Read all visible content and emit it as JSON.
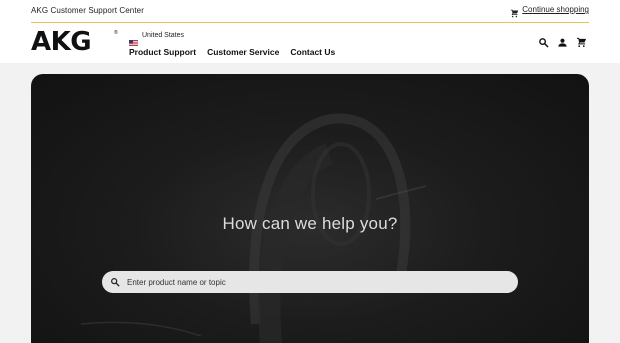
{
  "topbar": {
    "title": "AKG Customer Support Center",
    "continue_label": "Continue shopping",
    "cart_icon": "cart-icon"
  },
  "header": {
    "logo_text": "AKG",
    "logo_mark": "®",
    "country": "United States",
    "flag_icon": "us-flag-icon",
    "nav": [
      {
        "label": "Product Support"
      },
      {
        "label": "Customer Service"
      },
      {
        "label": "Contact Us"
      }
    ],
    "icons": [
      "search-icon",
      "account-icon",
      "cart-icon"
    ]
  },
  "hero": {
    "heading": "How can we help you?",
    "search": {
      "placeholder": "Enter product name or topic",
      "value": "",
      "icon": "search-icon"
    }
  },
  "colors": {
    "accent_rule": "#e8c15a",
    "hero_bg": "#1c1c1c",
    "search_bg": "#e6e6e6",
    "page_shade": "#f2f2f2"
  }
}
